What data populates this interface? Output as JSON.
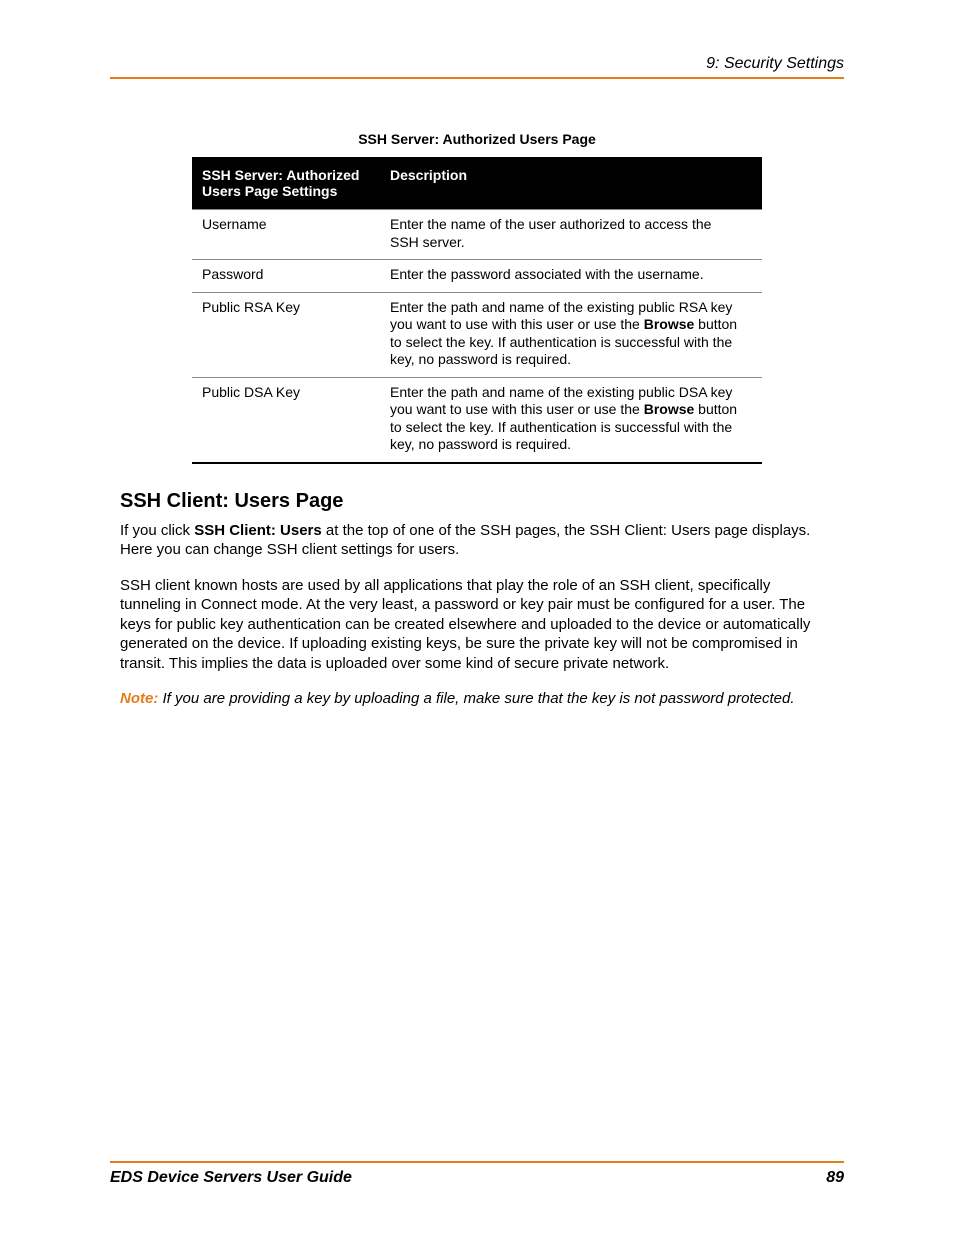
{
  "header": {
    "running": "9: Security Settings"
  },
  "table": {
    "caption": "SSH Server: Authorized Users Page",
    "head_setting": "SSH Server: Authorized Users Page Settings",
    "head_desc": "Description",
    "rows": [
      {
        "setting": "Username",
        "desc_pre": "Enter the name of the user authorized to access the SSH server.",
        "desc_bold": "",
        "desc_post": ""
      },
      {
        "setting": "Password",
        "desc_pre": "Enter the password associated with the username.",
        "desc_bold": "",
        "desc_post": ""
      },
      {
        "setting": "Public RSA Key",
        "desc_pre": "Enter the path and name of the existing public RSA key you want to use with this user or use the ",
        "desc_bold": "Browse",
        "desc_post": " button to select the key. If authentication is successful with the key, no password is required."
      },
      {
        "setting": "Public DSA Key",
        "desc_pre": "Enter the path and name of the existing public DSA key you want to use with this user or use the ",
        "desc_bold": "Browse",
        "desc_post": " button to select the key. If authentication is successful with the key, no password is required."
      }
    ]
  },
  "section": {
    "heading": "SSH Client: Users Page",
    "p1_pre": "If you click ",
    "p1_bold": "SSH Client: Users",
    "p1_post": " at the top of one of the SSH pages, the SSH Client: Users page displays. Here you can change SSH client settings for users.",
    "p2": "SSH client known hosts are used by all applications that play the role of an SSH client, specifically tunneling in Connect mode. At the very least, a password or key pair must be configured for a user. The keys for public key authentication can be created elsewhere and uploaded to the device or automatically generated on the device. If uploading existing keys, be sure the private key will not be compromised in transit. This implies the data is uploaded over some kind of secure private network.",
    "note_label": "Note:",
    "note_text": " If you are providing a key by uploading a file, make sure that the key is not password protected."
  },
  "footer": {
    "title": "EDS Device Servers User Guide",
    "page": "89"
  }
}
